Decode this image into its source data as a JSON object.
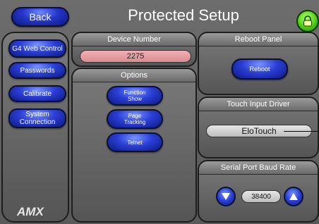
{
  "header": {
    "title": "Protected Setup",
    "back_label": "Back"
  },
  "sidebar": {
    "items": [
      {
        "label": "G4 Web Control"
      },
      {
        "label": "Passwords"
      },
      {
        "label": "Calibrate"
      },
      {
        "label": "System Connection"
      }
    ]
  },
  "device_number": {
    "title": "Device Number",
    "value": "2275"
  },
  "options": {
    "title": "Options",
    "buttons": [
      {
        "label": "Function Show"
      },
      {
        "label": "Page Tracking"
      },
      {
        "label": "Telnet"
      }
    ]
  },
  "reboot": {
    "title": "Reboot Panel",
    "button_label": "Reboot"
  },
  "touch_driver": {
    "title": "Touch Input Driver",
    "value": "EloTouch"
  },
  "baud": {
    "title": "Serial Port Baud Rate",
    "value": "38400"
  },
  "logo": {
    "text": "AMX"
  },
  "colors": {
    "accent": "#2b3fd6",
    "lock_green": "#4bd010",
    "device_field": "#f2b0b4"
  },
  "icons": {
    "lock": "lock-icon",
    "down": "down-arrow-icon",
    "up": "up-arrow-icon"
  }
}
